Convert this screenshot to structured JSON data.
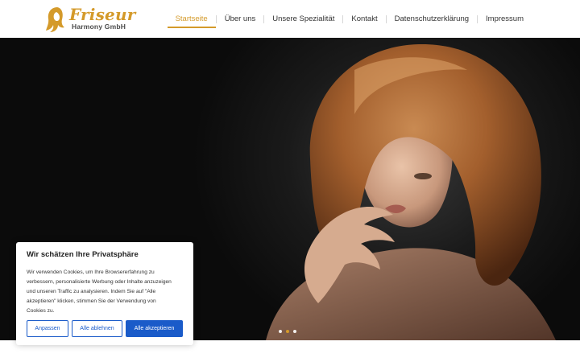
{
  "brand": {
    "name": "Friseur",
    "subtitle": "Harmony GmbH",
    "logo_icon": "woman-silhouette-logo"
  },
  "nav": {
    "items": [
      {
        "label": "Startseite",
        "active": true
      },
      {
        "label": "Über uns",
        "active": false
      },
      {
        "label": "Unsere Spezialität",
        "active": false
      },
      {
        "label": "Kontakt",
        "active": false
      },
      {
        "label": "Datenschutzerklärung",
        "active": false
      },
      {
        "label": "Impressum",
        "active": false
      }
    ]
  },
  "hero": {
    "image": "woman-with-bob-haircut",
    "slides_total": 3,
    "active_slide": 2
  },
  "cookie_banner": {
    "title": "Wir schätzen Ihre Privatsphäre",
    "text_lines": [
      "Wir verwenden Cookies, um Ihre Browsererfahrung zu",
      "verbessern, personalisierte Werbung oder Inhalte anzuzeigen",
      "und unseren Traffic zu analysieren. Indem Sie auf \"Alle",
      "akzeptieren\" klicken, stimmen Sie der Verwendung von",
      "Cookies zu."
    ],
    "customize_label": "Anpassen",
    "reject_label": "Alle ablehnen",
    "accept_label": "Alle akzeptieren"
  },
  "colors": {
    "accent": "#d49a2a",
    "button_blue": "#1a5bc9",
    "hero_bg": "#1a1a1a"
  }
}
